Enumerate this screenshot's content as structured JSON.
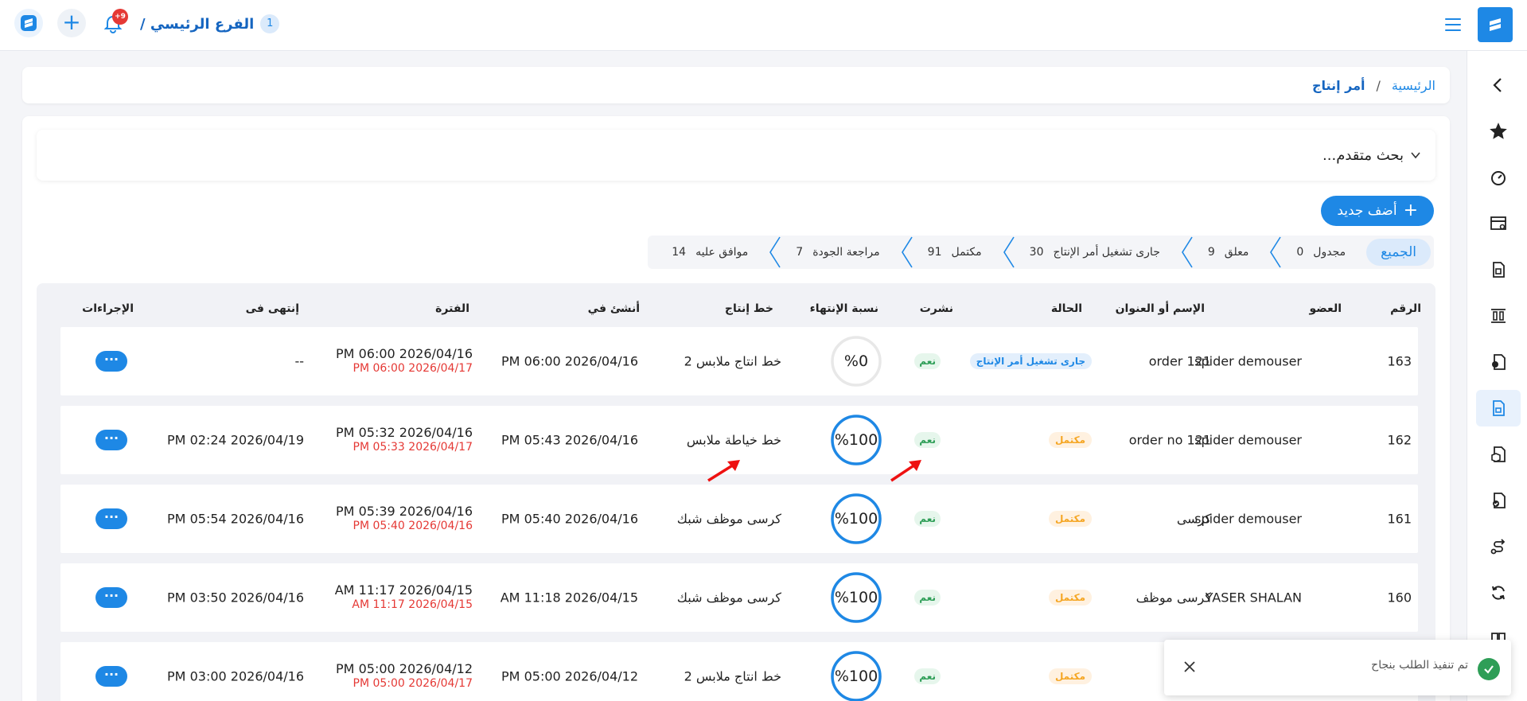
{
  "header": {
    "branch_number": "1",
    "branch_name": "الفرع الرئيسي /",
    "notification_badge": "+9"
  },
  "breadcrumb": {
    "home": "الرئيسية",
    "separator": "/",
    "current": "أمر إنتاج"
  },
  "search": {
    "label": "بحث متقدم..."
  },
  "actions": {
    "add_new": "أضف جديد"
  },
  "status_tabs": {
    "all": "الجميع",
    "items": [
      {
        "label": "مجدول",
        "count": "0"
      },
      {
        "label": "معلق",
        "count": "9"
      },
      {
        "label": "جارى تشغيل أمر الإنتاج",
        "count": "30"
      },
      {
        "label": "مكتمل",
        "count": "91"
      },
      {
        "label": "مراجعة الجودة",
        "count": "7"
      },
      {
        "label": "موافق عليه",
        "count": "14"
      }
    ]
  },
  "table": {
    "headers": {
      "number": "الرقم",
      "member": "العضو",
      "title": "الإسم أو العنوان",
      "status": "الحالة",
      "published": "نشرت",
      "completion": "نسبة الإنتهاء",
      "line": "خط إنتاج",
      "created": "أنشئ في",
      "period": "الفترة",
      "ended": "إنتهى فى",
      "actions": "الإجراءات"
    },
    "rows": [
      {
        "number": "163",
        "member": "spider demouser",
        "title": "order 121",
        "status": "جارى تشغيل أمر الإنتاج",
        "status_kind": "running",
        "published": "نعم",
        "completion": 0,
        "completion_label": "%0",
        "line": "خط انتاج ملابس 2",
        "created": "2026/04/16 06:00 PM",
        "period_start": "2026/04/16 06:00 PM",
        "period_end": "2026/04/17 06:00 PM",
        "ended": "--",
        "more": "···"
      },
      {
        "number": "162",
        "member": "spider demouser",
        "title": "order no 121",
        "status": "مكتمل",
        "status_kind": "done",
        "published": "نعم",
        "completion": 100,
        "completion_label": "%100",
        "line": "خط خياطة ملابس",
        "created": "2026/04/16 05:43 PM",
        "period_start": "2026/04/16 05:32 PM",
        "period_end": "2026/04/17 05:33 PM",
        "ended": "2026/04/19 02:24 PM",
        "more": "···"
      },
      {
        "number": "161",
        "member": "spider demouser",
        "title": "كرسى",
        "status": "مكتمل",
        "status_kind": "done",
        "published": "نعم",
        "completion": 100,
        "completion_label": "%100",
        "line": "كرسى موظف شبك",
        "created": "2026/04/16 05:40 PM",
        "period_start": "2026/04/16 05:39 PM",
        "period_end": "2026/04/16 05:40 PM",
        "ended": "2026/04/16 05:54 PM",
        "more": "···"
      },
      {
        "number": "160",
        "member": "YASER SHALAN",
        "title": "كرسى موظف",
        "status": "مكتمل",
        "status_kind": "done",
        "published": "نعم",
        "completion": 100,
        "completion_label": "%100",
        "line": "كرسى موظف شبك",
        "created": "2026/04/15 11:18 AM",
        "period_start": "2026/04/15 11:17 AM",
        "period_end": "2026/04/15 11:17 AM",
        "ended": "2026/04/16 03:50 PM",
        "more": "···"
      },
      {
        "number": "",
        "member": "",
        "title": "",
        "status": "مكتمل",
        "status_kind": "done",
        "published": "نعم",
        "completion": 100,
        "completion_label": "%100",
        "line": "خط انتاج ملابس 2",
        "created": "2026/04/12 05:00 PM",
        "period_start": "2026/04/12 05:00 PM",
        "period_end": "2026/04/17 05:00 PM",
        "ended": "2026/04/16 03:00 PM",
        "more": "···"
      }
    ]
  },
  "toast": {
    "message": "تم تنفيذ الطلب بنجاح"
  },
  "colors": {
    "primary": "#1e88e5",
    "success": "#2e9e57",
    "warning": "#f5a623",
    "danger": "#e53935"
  },
  "icons": {
    "sidebar": [
      "chevron-left-icon",
      "star-icon",
      "dashboard-icon",
      "printer-icon",
      "document-icon",
      "columns-icon",
      "exchange-icon",
      "production-icon",
      "box-icon",
      "checklist-icon",
      "route-icon",
      "sync-icon",
      "book-icon"
    ]
  }
}
